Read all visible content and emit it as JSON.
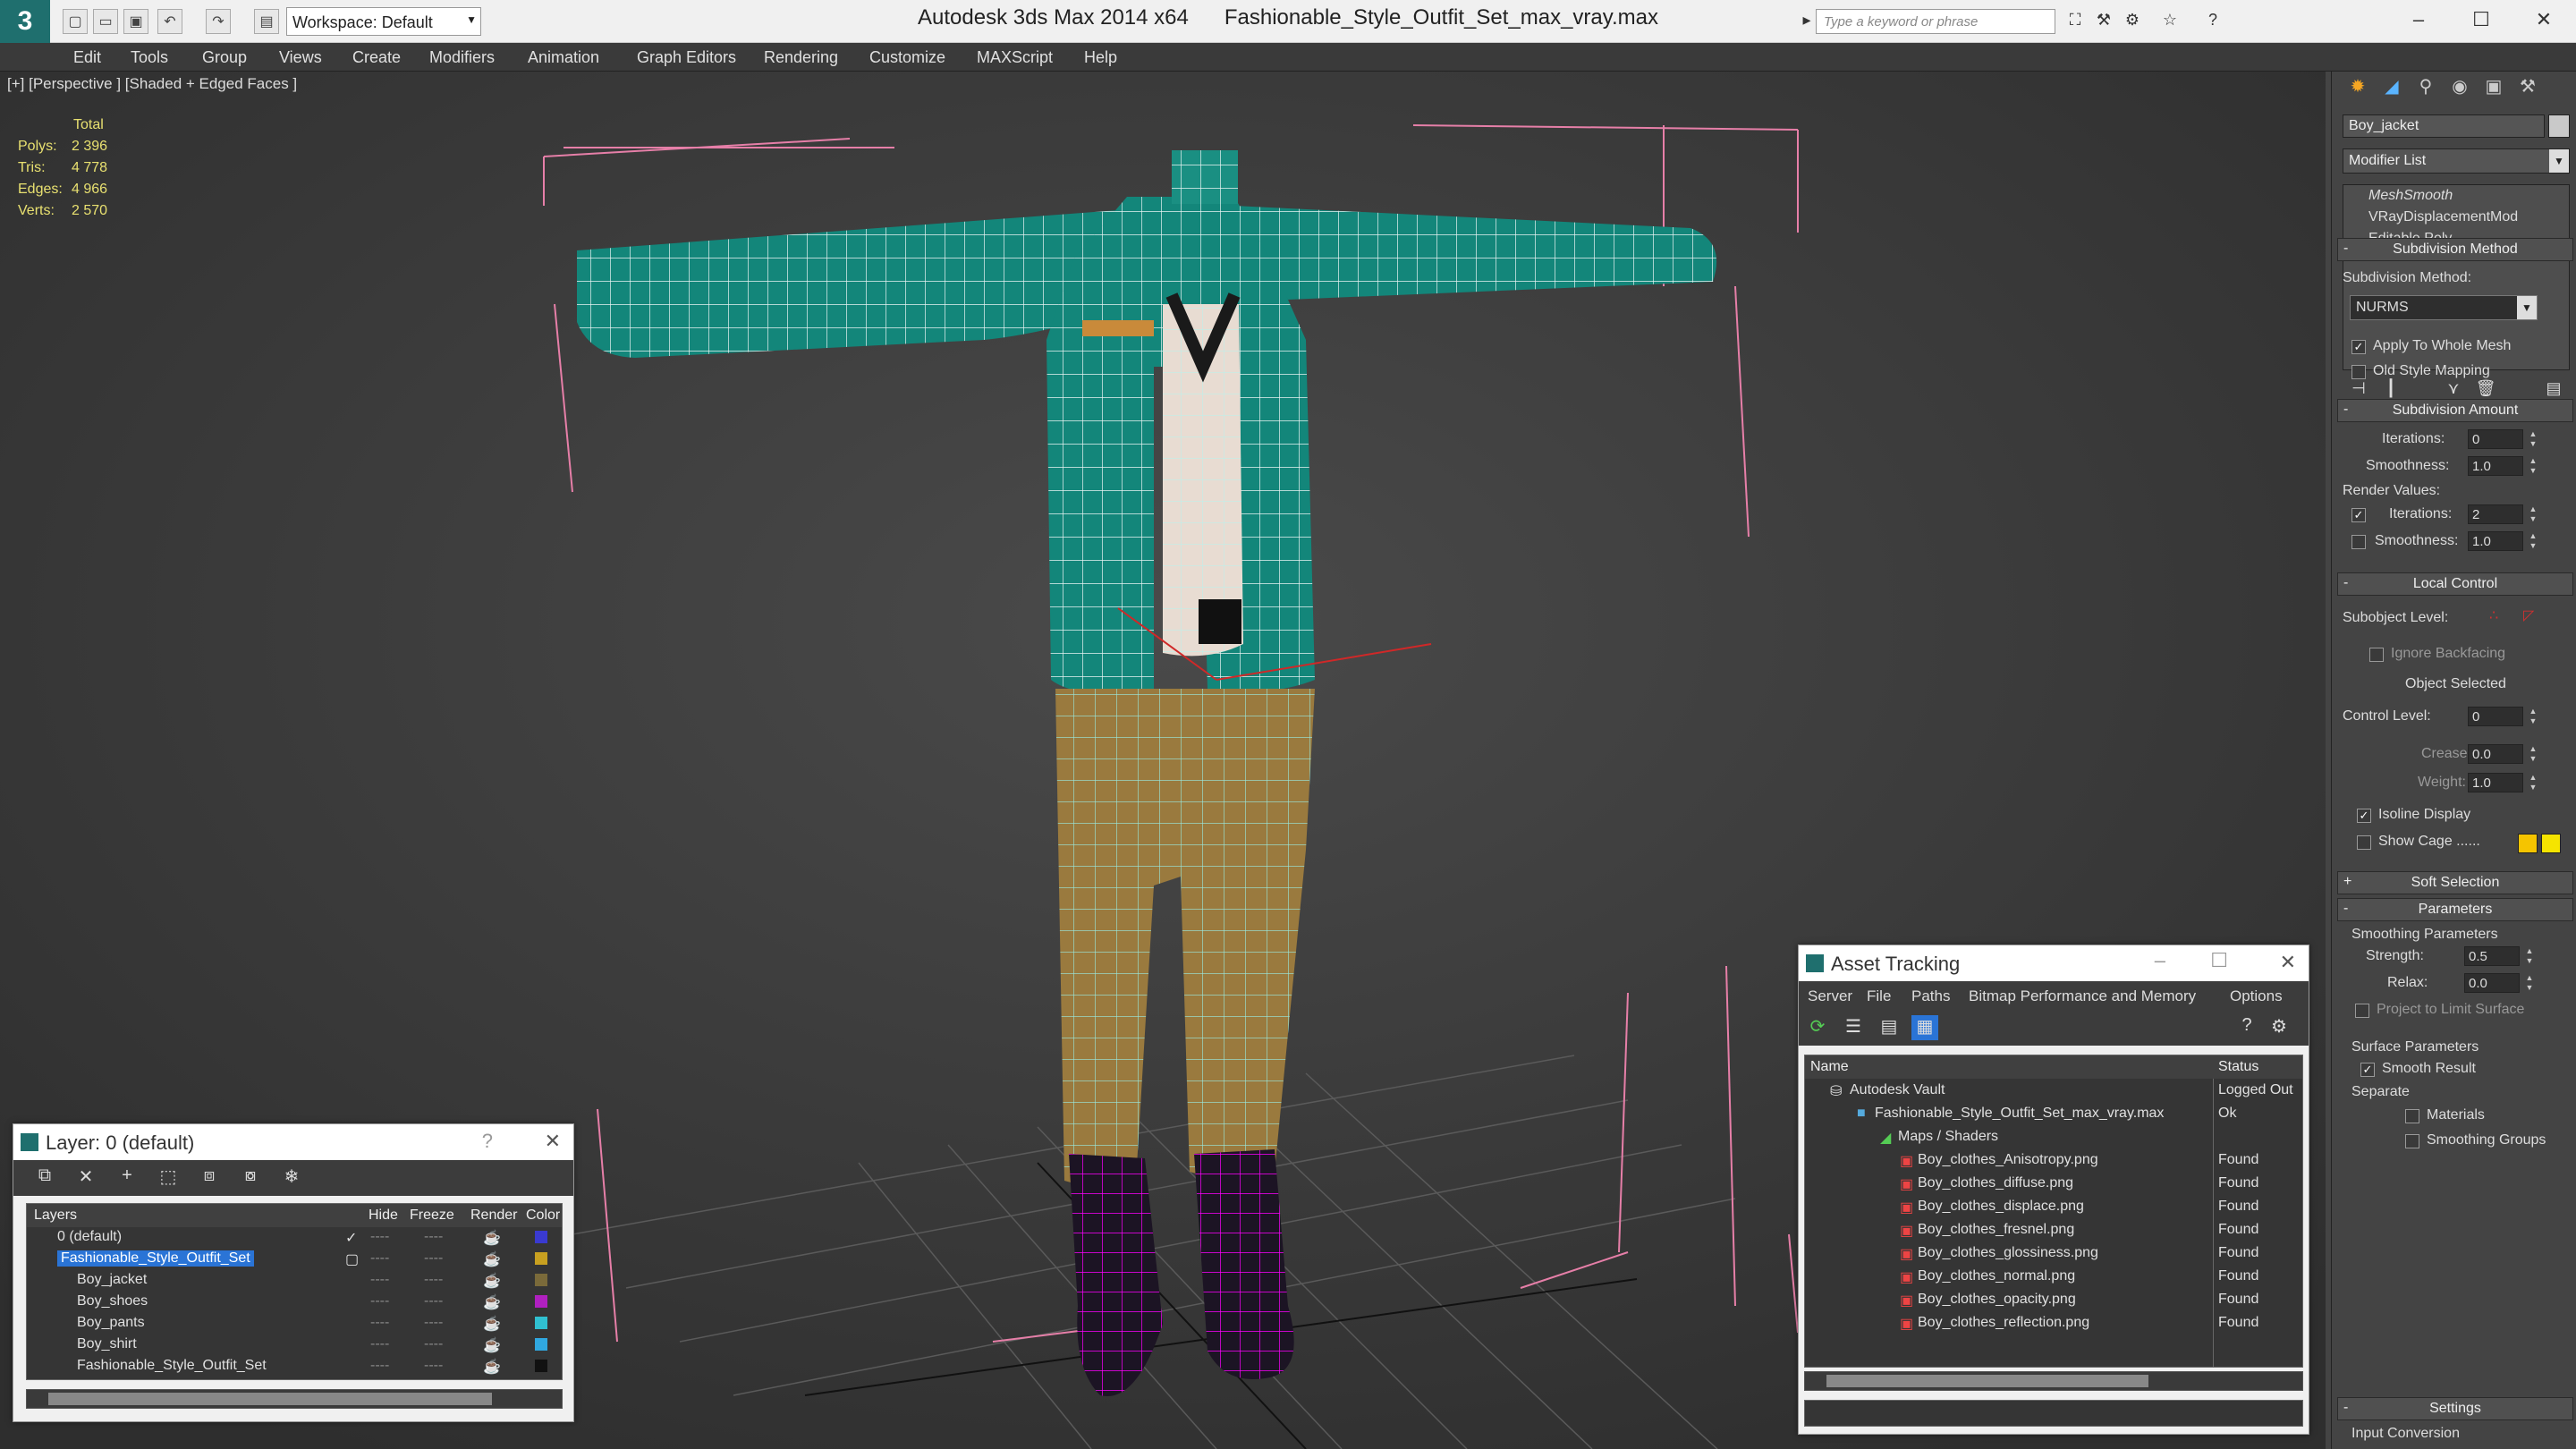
{
  "app": {
    "logo": "3",
    "title": "Autodesk 3ds Max  2014 x64",
    "file": "Fashionable_Style_Outfit_Set_max_vray.max",
    "workspace": "Workspace: Default",
    "search_placeholder": "Type a keyword or phrase"
  },
  "menu": [
    "Edit",
    "Tools",
    "Group",
    "Views",
    "Create",
    "Modifiers",
    "Animation",
    "Graph Editors",
    "Rendering",
    "Customize",
    "MAXScript",
    "Help"
  ],
  "viewport": {
    "label": "[+] [Perspective ] [Shaded + Edged Faces ]",
    "stats_header": "Total",
    "stats": [
      {
        "k": "Polys:",
        "v": "2 396"
      },
      {
        "k": "Tris:",
        "v": "4 778"
      },
      {
        "k": "Edges:",
        "v": "4 966"
      },
      {
        "k": "Verts:",
        "v": "2 570"
      }
    ]
  },
  "command_panel": {
    "object_name": "Boy_jacket",
    "modifier_list": "Modifier List",
    "stack": [
      "MeshSmooth",
      "VRayDisplacementMod",
      "Editable Poly"
    ],
    "subdivision_method": {
      "title": "Subdivision Method",
      "label": "Subdivision Method:",
      "value": "NURMS",
      "apply_whole_mesh": "Apply To Whole Mesh",
      "old_style_mapping": "Old Style Mapping"
    },
    "subdivision_amount": {
      "title": "Subdivision Amount",
      "iterations_label": "Iterations:",
      "iterations": "0",
      "smoothness_label": "Smoothness:",
      "smoothness": "1.0",
      "render_values": "Render Values:",
      "r_iterations_label": "Iterations:",
      "r_iterations": "2",
      "r_smoothness_label": "Smoothness:",
      "r_smoothness": "1.0"
    },
    "local_control": {
      "title": "Local Control",
      "subobject": "Subobject Level:",
      "ignore_backfacing": "Ignore Backfacing",
      "object_selected": "Object Selected",
      "control_level_label": "Control Level:",
      "control_level": "0",
      "crease_label": "Crease:",
      "crease": "0.0",
      "weight_label": "Weight:",
      "weight": "1.0",
      "isoline": "Isoline Display",
      "show_cage": "Show Cage ......",
      "cage_colors": [
        "#f5c400",
        "#f5e400"
      ]
    },
    "soft_selection": "Soft Selection",
    "parameters": {
      "title": "Parameters",
      "smoothing": "Smoothing Parameters",
      "strength_label": "Strength:",
      "strength": "0.5",
      "relax_label": "Relax:",
      "relax": "0.0",
      "project": "Project to Limit Surface",
      "surface": "Surface Parameters",
      "smooth_result": "Smooth Result",
      "separate": "Separate",
      "materials": "Materials",
      "smoothing_groups": "Smoothing Groups"
    },
    "settings": "Settings",
    "input_conversion": "Input Conversion"
  },
  "layer_window": {
    "title": "Layer: 0 (default)",
    "help": "?",
    "columns": [
      "Layers",
      "Hide",
      "Freeze",
      "Render",
      "Color"
    ],
    "rows": [
      {
        "name": "0 (default)",
        "color": "#3a3ad0",
        "indent": 1,
        "check": "✓"
      },
      {
        "name": "Fashionable_Style_Outfit_Set",
        "color": "#c8a020",
        "indent": 1,
        "check": ""
      },
      {
        "name": "Boy_jacket",
        "color": "#7a6a3a",
        "indent": 2,
        "check": ""
      },
      {
        "name": "Boy_shoes",
        "color": "#b020c0",
        "indent": 2,
        "check": ""
      },
      {
        "name": "Boy_pants",
        "color": "#30c0d0",
        "indent": 2,
        "check": ""
      },
      {
        "name": "Boy_shirt",
        "color": "#30a8e0",
        "indent": 2,
        "check": ""
      },
      {
        "name": "Fashionable_Style_Outfit_Set",
        "color": "#111111",
        "indent": 2,
        "check": ""
      }
    ],
    "dash": "----"
  },
  "asset_window": {
    "title": "Asset Tracking",
    "menu": [
      "Server",
      "File",
      "Paths",
      "Bitmap Performance and Memory",
      "Options"
    ],
    "columns": [
      "Name",
      "Status"
    ],
    "rows": [
      {
        "name": "Autodesk Vault",
        "status": "Logged Out",
        "indent": 0
      },
      {
        "name": "Fashionable_Style_Outfit_Set_max_vray.max",
        "status": "Ok",
        "indent": 1
      },
      {
        "name": "Maps / Shaders",
        "status": "",
        "indent": 2
      },
      {
        "name": "Boy_clothes_Anisotropy.png",
        "status": "Found",
        "indent": 3
      },
      {
        "name": "Boy_clothes_diffuse.png",
        "status": "Found",
        "indent": 3
      },
      {
        "name": "Boy_clothes_displace.png",
        "status": "Found",
        "indent": 3
      },
      {
        "name": "Boy_clothes_fresnel.png",
        "status": "Found",
        "indent": 3
      },
      {
        "name": "Boy_clothes_glossiness.png",
        "status": "Found",
        "indent": 3
      },
      {
        "name": "Boy_clothes_normal.png",
        "status": "Found",
        "indent": 3
      },
      {
        "name": "Boy_clothes_opacity.png",
        "status": "Found",
        "indent": 3
      },
      {
        "name": "Boy_clothes_reflection.png",
        "status": "Found",
        "indent": 3
      }
    ]
  }
}
